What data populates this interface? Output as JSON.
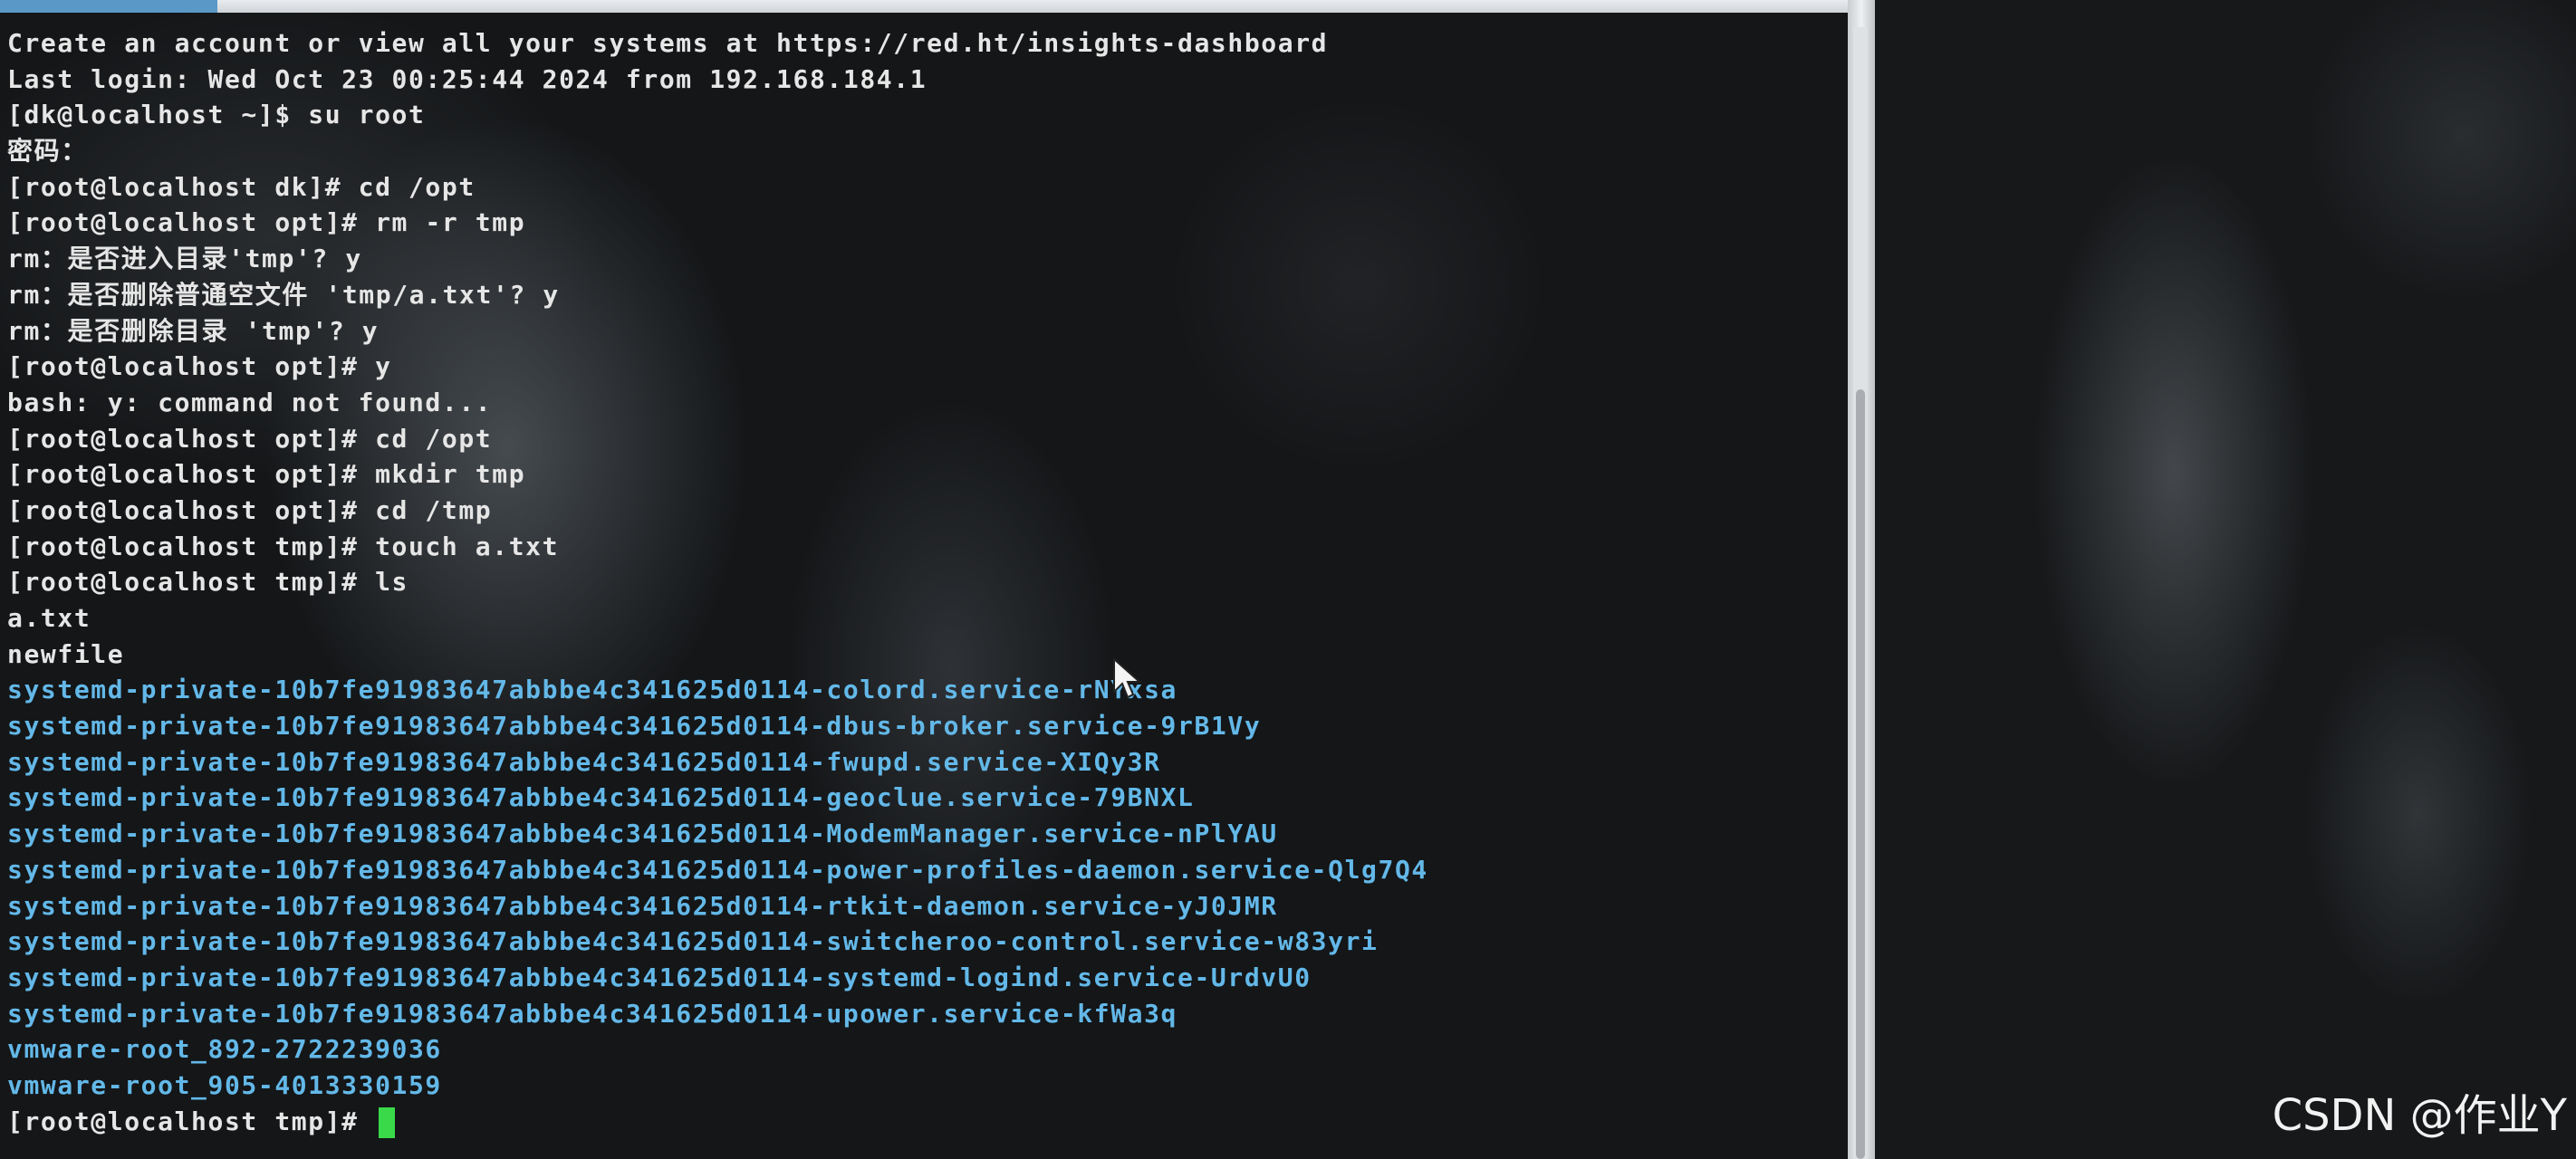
{
  "terminal": {
    "lines": [
      {
        "text": "Create an account or view all your systems at https://red.ht/insights-dashboard",
        "kind": "output"
      },
      {
        "text": "Last login: Wed Oct 23 00:25:44 2024 from 192.168.184.1",
        "kind": "output"
      },
      {
        "text": "[dk@localhost ~]$ su root",
        "kind": "command"
      },
      {
        "text": "密码：",
        "kind": "output"
      },
      {
        "text": "[root@localhost dk]# cd /opt",
        "kind": "command"
      },
      {
        "text": "[root@localhost opt]# rm -r tmp",
        "kind": "command"
      },
      {
        "text": "rm：是否进入目录'tmp'? y",
        "kind": "output"
      },
      {
        "text": "rm：是否删除普通空文件 'tmp/a.txt'? y",
        "kind": "output"
      },
      {
        "text": "rm：是否删除目录 'tmp'? y",
        "kind": "output"
      },
      {
        "text": "[root@localhost opt]# y",
        "kind": "command"
      },
      {
        "text": "bash: y: command not found...",
        "kind": "output"
      },
      {
        "text": "[root@localhost opt]# cd /opt",
        "kind": "command"
      },
      {
        "text": "[root@localhost opt]# mkdir tmp",
        "kind": "command"
      },
      {
        "text": "[root@localhost opt]# cd /tmp",
        "kind": "command"
      },
      {
        "text": "[root@localhost tmp]# touch a.txt",
        "kind": "command"
      },
      {
        "text": "[root@localhost tmp]# ls",
        "kind": "command"
      },
      {
        "text": "a.txt",
        "kind": "output"
      },
      {
        "text": "newfile",
        "kind": "output"
      },
      {
        "text": "systemd-private-10b7fe91983647abbbe4c341625d0114-colord.service-rNYxsa",
        "kind": "dir"
      },
      {
        "text": "systemd-private-10b7fe91983647abbbe4c341625d0114-dbus-broker.service-9rB1Vy",
        "kind": "dir"
      },
      {
        "text": "systemd-private-10b7fe91983647abbbe4c341625d0114-fwupd.service-XIQy3R",
        "kind": "dir"
      },
      {
        "text": "systemd-private-10b7fe91983647abbbe4c341625d0114-geoclue.service-79BNXL",
        "kind": "dir"
      },
      {
        "text": "systemd-private-10b7fe91983647abbbe4c341625d0114-ModemManager.service-nPlYAU",
        "kind": "dir"
      },
      {
        "text": "systemd-private-10b7fe91983647abbbe4c341625d0114-power-profiles-daemon.service-Qlg7Q4",
        "kind": "dir"
      },
      {
        "text": "systemd-private-10b7fe91983647abbbe4c341625d0114-rtkit-daemon.service-yJ0JMR",
        "kind": "dir"
      },
      {
        "text": "systemd-private-10b7fe91983647abbbe4c341625d0114-switcheroo-control.service-w83yri",
        "kind": "dir"
      },
      {
        "text": "systemd-private-10b7fe91983647abbbe4c341625d0114-systemd-logind.service-UrdvU0",
        "kind": "dir"
      },
      {
        "text": "systemd-private-10b7fe91983647abbbe4c341625d0114-upower.service-kfWa3q",
        "kind": "dir"
      },
      {
        "text": "vmware-root_892-2722239036",
        "kind": "dir"
      },
      {
        "text": "vmware-root_905-4013330159",
        "kind": "dir"
      }
    ],
    "prompt": "[root@localhost tmp]# "
  },
  "watermark": "CSDN @作业Y",
  "colors": {
    "terminal_text": "#e6e6e6",
    "directory_text": "#63b8e8",
    "cursor": "#3ad94a",
    "terminal_bg": "#141618"
  }
}
